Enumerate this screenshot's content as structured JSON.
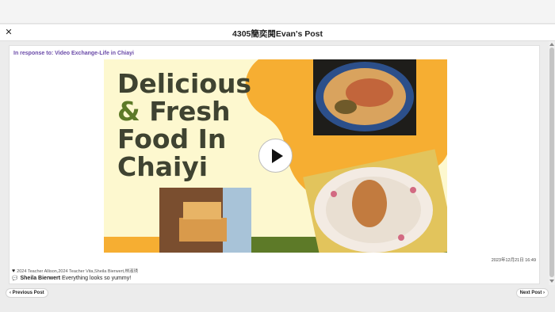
{
  "header": {
    "close_glyph": "✕",
    "title": "4305簡奕閱Evan's Post"
  },
  "post": {
    "response_link": "In response to: Video Exchange-Life in Chiayi",
    "video": {
      "title_line1": "Delicious",
      "title_amp": "&",
      "title_line2_rest": " Fresh",
      "title_line3": "Food In",
      "title_line4": "Chaiyi",
      "play_icon": "play-icon",
      "colors": {
        "background": "#fdf8cf",
        "accent_orange": "#f6ae32",
        "accent_green": "#5d7a28",
        "title_text": "#3f4331"
      }
    },
    "timestamp": "2023年12月21日 16:49",
    "likes_text": "2024 Teacher Allison,2024 Teacher Vita,Sheila Bierwert,林淑琇",
    "comment": {
      "author": "Sheila Bierwert",
      "text": " Everything looks so yummy!"
    }
  },
  "footer": {
    "prev_label": "‹ Previous Post",
    "next_label": "Next Post ›"
  },
  "colors": {
    "link": "#6a4aa8",
    "page_bg": "#ececec"
  }
}
